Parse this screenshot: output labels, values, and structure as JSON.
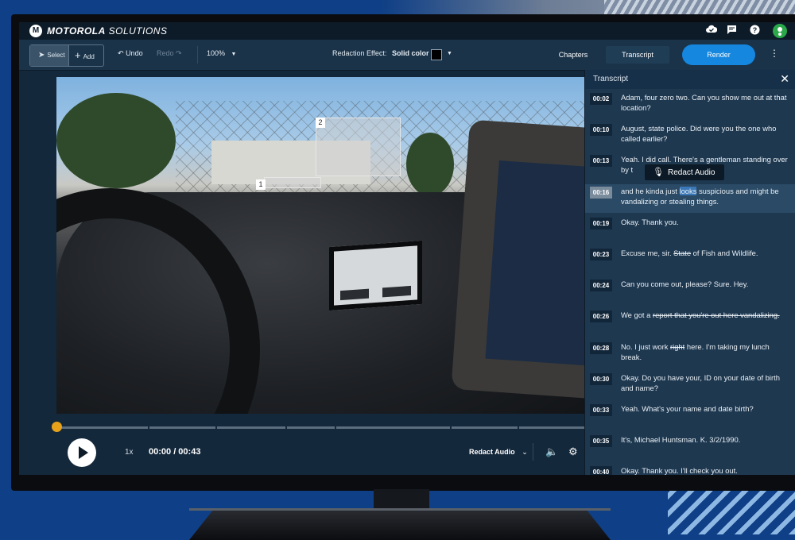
{
  "app": {
    "brand_bold": "MOTOROLA",
    "brand_light": "SOLUTIONS",
    "logo_letter": "M",
    "icons": [
      "cloud-check-icon",
      "comment-icon",
      "help-icon",
      "user-avatar-icon"
    ]
  },
  "toolbar": {
    "select_label": "Select",
    "add_label": "Add",
    "undo_label": "Undo",
    "redo_label": "Redo",
    "zoom_value": "100%",
    "redaction_effect_label": "Redaction Effect:",
    "redaction_effect_value": "Solid color",
    "redaction_color": "#000000",
    "chapters_label": "Chapters",
    "transcript_tab_label": "Transcript",
    "render_label": "Render",
    "accent_color": "#1587df"
  },
  "video": {
    "redaction_labels": [
      "1",
      "2"
    ]
  },
  "player": {
    "progress_fraction": 0.0,
    "speed": "1x",
    "time": "00:00 / 00:43",
    "redact_audio_label": "Redact Audio"
  },
  "transcript": {
    "title": "Transcript",
    "tooltip_label": "Redact Audio",
    "selected_index": 3,
    "entries": [
      {
        "time": "00:02",
        "text": "Adam, four zero two. Can you show me out at that location?"
      },
      {
        "time": "00:10",
        "text": "August, state police. Did were you the one who called earlier?"
      },
      {
        "time": "00:13",
        "text": "Yeah. I did call. There's a gentleman standing over by t"
      },
      {
        "time": "00:16",
        "pre": "and he kinda just ",
        "highlight": "looks",
        "post": " suspicious and might be vandalizing or stealing things."
      },
      {
        "time": "00:19",
        "text": "Okay. Thank you."
      },
      {
        "time": "00:23",
        "pre": "Excuse me, sir. ",
        "strike": "State",
        "post": " of Fish and Wildlife."
      },
      {
        "time": "00:24",
        "text": "Can you come out, please? Sure. Hey."
      },
      {
        "time": "00:26",
        "pre": "We got a ",
        "strike": "report that you're out here vandalizing.",
        "post": ""
      },
      {
        "time": "00:28",
        "pre": "No. I just work ",
        "strike": "right",
        "post": " here. I'm taking my lunch break."
      },
      {
        "time": "00:30",
        "text": "Okay. Do you have your, ID on your date of birth and name?"
      },
      {
        "time": "00:33",
        "text": "Yeah. What's your name and date birth?"
      },
      {
        "time": "00:35",
        "text": "It's, Michael Huntsman. K. 3/2/1990."
      },
      {
        "time": "00:40",
        "text": "Okay. Thank you. I'll check you out."
      }
    ]
  }
}
